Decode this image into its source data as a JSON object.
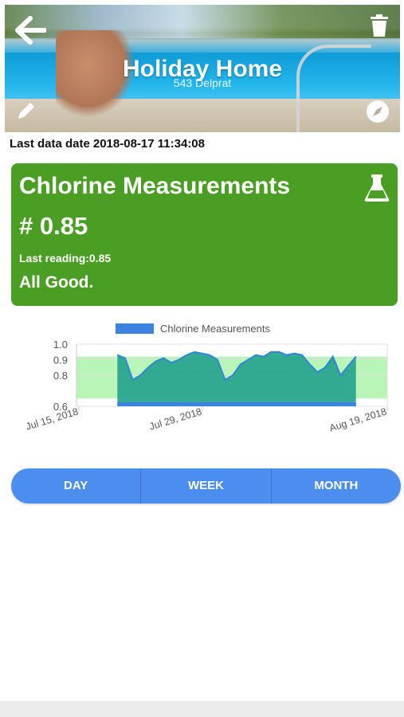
{
  "header": {
    "title": "Holiday Home",
    "subtitle": "543 Delprat",
    "icons": {
      "back": "arrow-left-icon",
      "delete": "trash-icon",
      "edit": "pencil-icon",
      "location": "compass-icon"
    }
  },
  "last_data": {
    "label": "Last data date",
    "value": "2018-08-17 11:34:08"
  },
  "card": {
    "title": "Chlorine Measurements",
    "value": "# 0.85",
    "last_reading": "Last reading:0.85",
    "status": "All Good.",
    "icon": "flask-icon",
    "color": "#4a9e23"
  },
  "chart_data": {
    "type": "area",
    "title": "",
    "legend": [
      "Chlorine Measurements"
    ],
    "legend_position": "top-center",
    "x_ticks": [
      "Jul 15, 2018",
      "Jul 29, 2018",
      "Aug 19, 2018"
    ],
    "y_ticks": [
      "0.6",
      "0.8",
      "0.9",
      "1.0"
    ],
    "ylim": [
      0.6,
      1.0
    ],
    "good_band": [
      0.65,
      0.92
    ],
    "series": [
      {
        "name": "Chlorine Measurements",
        "color": "#2aa58f",
        "x": [
          "2018-07-17",
          "2018-07-18",
          "2018-07-19",
          "2018-07-20",
          "2018-07-21",
          "2018-07-22",
          "2018-07-23",
          "2018-07-24",
          "2018-07-25",
          "2018-07-26",
          "2018-07-27",
          "2018-07-28",
          "2018-07-29",
          "2018-07-30",
          "2018-07-31",
          "2018-08-01",
          "2018-08-02",
          "2018-08-03",
          "2018-08-04",
          "2018-08-05",
          "2018-08-06",
          "2018-08-07",
          "2018-08-08",
          "2018-08-09",
          "2018-08-10",
          "2018-08-11",
          "2018-08-12",
          "2018-08-13",
          "2018-08-14",
          "2018-08-15",
          "2018-08-16",
          "2018-08-17"
        ],
        "values": [
          0.93,
          0.91,
          0.77,
          0.8,
          0.85,
          0.89,
          0.91,
          0.88,
          0.9,
          0.93,
          0.95,
          0.94,
          0.93,
          0.9,
          0.77,
          0.8,
          0.87,
          0.9,
          0.93,
          0.92,
          0.95,
          0.95,
          0.93,
          0.94,
          0.93,
          0.87,
          0.82,
          0.85,
          0.92,
          0.8,
          0.86,
          0.92
        ]
      }
    ]
  },
  "range_buttons": [
    {
      "label": "DAY"
    },
    {
      "label": "WEEK"
    },
    {
      "label": "MONTH"
    }
  ],
  "colors": {
    "accent": "#4c8ef0",
    "good": "#4a9e23",
    "band": "#b9f5b6"
  }
}
